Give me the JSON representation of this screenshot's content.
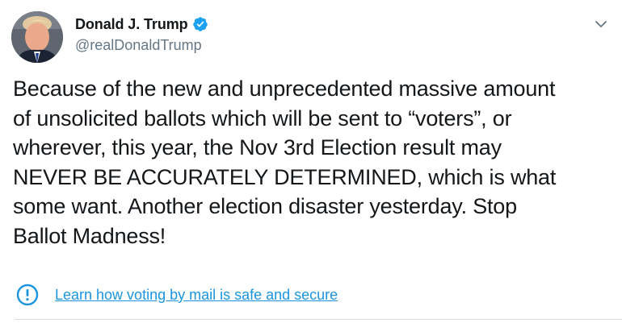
{
  "tweet": {
    "author": {
      "display_name": "Donald J. Trump",
      "handle": "@realDonaldTrump",
      "verified": true,
      "avatar_icon": "profile-photo"
    },
    "menu_icon": "chevron-down-icon",
    "text": "Because of the new and unprecedented massive amount\nof unsolicited ballots which will be sent to “voters”, or\nwherever, this year, the Nov 3rd Election result may\nNEVER BE ACCURATELY DETERMINED, which is what\nsome want. Another election disaster yesterday. Stop\nBallot Madness!",
    "label": {
      "icon": "exclamation-circle-icon",
      "link_text": "Learn how voting by mail is safe and secure"
    }
  },
  "colors": {
    "text": "#14171a",
    "secondary": "#657786",
    "accent": "#1b95e0",
    "verified_badge": "#1da1f2"
  }
}
